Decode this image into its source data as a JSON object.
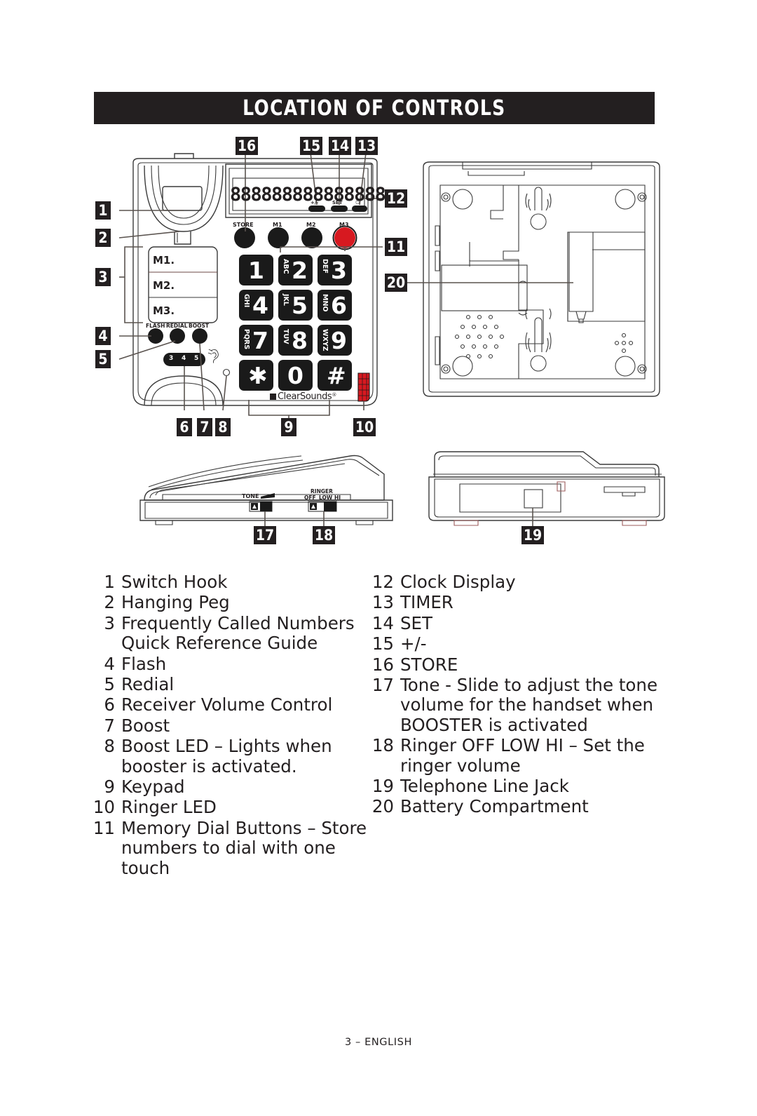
{
  "page": {
    "heading": "LOCATION OF CONTROLS",
    "footer": "3 – ENGLISH"
  },
  "legend": {
    "left_column": [
      {
        "num": "1",
        "label": "Switch Hook"
      },
      {
        "num": "2",
        "label": "Hanging Peg"
      },
      {
        "num": "3",
        "label": "Frequently Called Numbers Quick Reference Guide"
      },
      {
        "num": "4",
        "label": "Flash"
      },
      {
        "num": "5",
        "label": "Redial"
      },
      {
        "num": "6",
        "label": "Receiver Volume Control"
      },
      {
        "num": "7",
        "label": "Boost"
      },
      {
        "num": "8",
        "label": "Boost LED – Lights when booster is activated."
      },
      {
        "num": "9",
        "label": "Keypad"
      },
      {
        "num": "10",
        "label": "Ringer LED"
      },
      {
        "num": "11",
        "label": "Memory Dial Buttons – Store numbers to dial with one touch"
      }
    ],
    "right_column": [
      {
        "num": "12",
        "label": "Clock Display"
      },
      {
        "num": "13",
        "label": "TIMER"
      },
      {
        "num": "14",
        "label": "SET"
      },
      {
        "num": "15",
        "label": "+/-"
      },
      {
        "num": "16",
        "label": "STORE"
      },
      {
        "num": "17",
        "label": "Tone  - Slide to adjust the tone volume for the handset when BOOSTER is activated"
      },
      {
        "num": "18",
        "label": "Ringer  OFF LOW HI – Set the ringer volume"
      },
      {
        "num": "19",
        "label": "Telephone Line Jack"
      },
      {
        "num": "20",
        "label": "Battery Compartment"
      }
    ]
  },
  "callouts": {
    "c1": "1",
    "c2": "2",
    "c3": "3",
    "c4": "4",
    "c5": "5",
    "c6": "6",
    "c7": "7",
    "c8": "8",
    "c9": "9",
    "c10": "10",
    "c11": "11",
    "c12": "12",
    "c13": "13",
    "c14": "14",
    "c15": "15",
    "c16": "16",
    "c17": "17",
    "c18": "18",
    "c19": "19",
    "c20": "20"
  },
  "device": {
    "brand": "ClearSounds",
    "lcd_segments": "888888888888888",
    "display_buttons": [
      {
        "label": "+/-"
      },
      {
        "label": "SET"
      },
      {
        "label": "⏱"
      }
    ],
    "memory_buttons": [
      {
        "label": "STORE",
        "color": "#1a1a1a"
      },
      {
        "label": "M1",
        "color": "#1a1a1a"
      },
      {
        "label": "M2",
        "color": "#1a1a1a"
      },
      {
        "label": "M3",
        "color": "#d71920"
      }
    ],
    "quick_reference": [
      {
        "label": "M1."
      },
      {
        "label": "M2."
      },
      {
        "label": "M3."
      }
    ],
    "function_buttons": [
      {
        "label": "FLASH"
      },
      {
        "label": "REDIAL"
      },
      {
        "label": "BOOST"
      }
    ],
    "volume_slider": {
      "ticks": [
        "3",
        "4",
        "5"
      ]
    },
    "keypad": [
      {
        "digit": "1",
        "letters": ""
      },
      {
        "digit": "2",
        "letters": "ABC"
      },
      {
        "digit": "3",
        "letters": "DEF"
      },
      {
        "digit": "4",
        "letters": "GHI"
      },
      {
        "digit": "5",
        "letters": "JKL"
      },
      {
        "digit": "6",
        "letters": "MNO"
      },
      {
        "digit": "7",
        "letters": "PQRS"
      },
      {
        "digit": "8",
        "letters": "TUV"
      },
      {
        "digit": "9",
        "letters": "WXYZ"
      },
      {
        "digit": "✱",
        "letters": ""
      },
      {
        "digit": "0",
        "letters": ""
      },
      {
        "digit": "#",
        "letters": ""
      }
    ],
    "side_switches": {
      "tone_label": "TONE",
      "ringer_label": "RINGER",
      "ringer_positions": [
        "OFF",
        "LOW",
        "HI"
      ]
    }
  },
  "colors": {
    "ink": "#231f20",
    "banner_bg": "#231f20",
    "banner_text": "#ffffff",
    "accent_red": "#d71920",
    "key_black": "#1a1a1a",
    "outline": "#3a3a3a"
  }
}
